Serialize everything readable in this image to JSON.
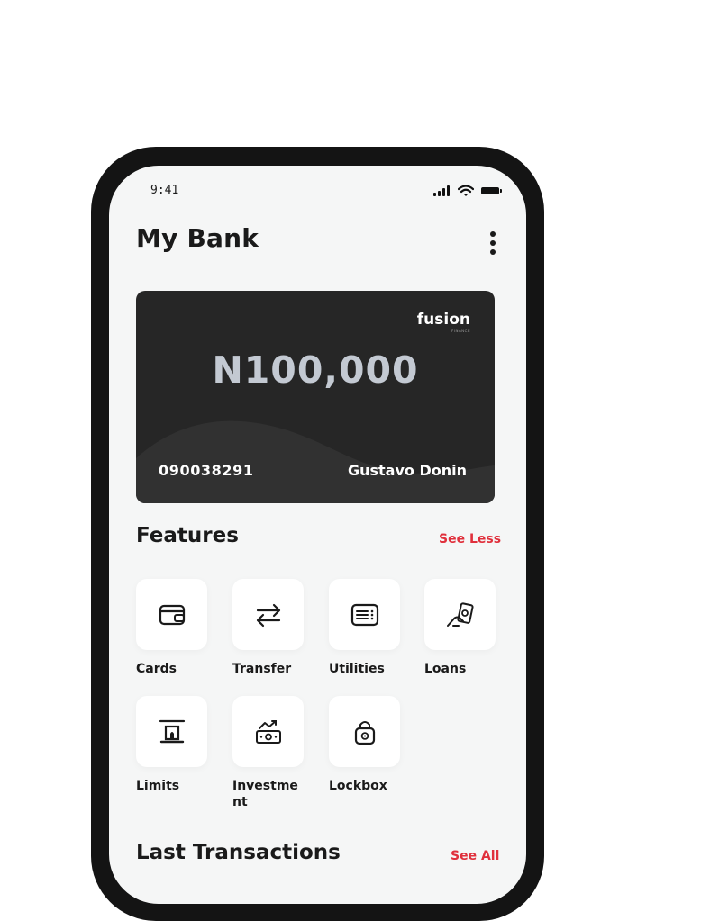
{
  "status_bar": {
    "time": "9:41"
  },
  "header": {
    "title": "My Bank",
    "menu_icon": "more-vertical-icon"
  },
  "card": {
    "brand": "fusion",
    "brand_tagline": "FINANCE",
    "balance": "N100,000",
    "account_number": "090038291",
    "holder_name": "Gustavo Donin",
    "background_color": "#262626",
    "balance_color": "#c3c9d2"
  },
  "features": {
    "title": "Features",
    "toggle_label": "See Less",
    "items": [
      {
        "label": "Cards",
        "icon": "card-icon"
      },
      {
        "label": "Transfer",
        "icon": "transfer-arrows-icon"
      },
      {
        "label": "Utilities",
        "icon": "bill-icon"
      },
      {
        "label": "Loans",
        "icon": "loan-hand-icon"
      },
      {
        "label": "Limits",
        "icon": "limit-icon"
      },
      {
        "label": "Investment",
        "icon": "investment-money-icon"
      },
      {
        "label": "Lockbox",
        "icon": "lockbox-icon"
      }
    ]
  },
  "transactions": {
    "title": "Last Transactions",
    "link_label": "See All"
  },
  "colors": {
    "accent": "#e0303c",
    "screen_bg": "#f5f6f6",
    "frame": "#141414"
  }
}
